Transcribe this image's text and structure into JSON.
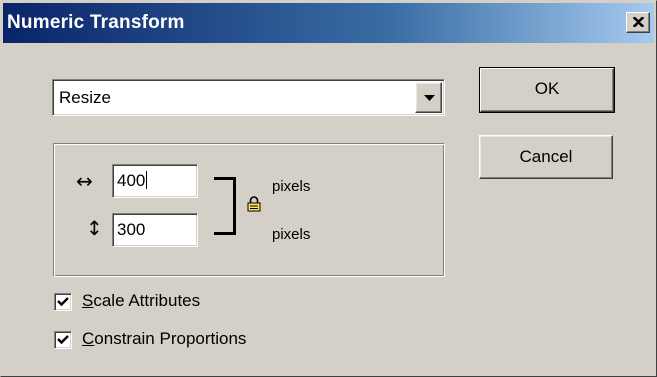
{
  "window": {
    "title": "Numeric Transform",
    "close_icon": "close-icon"
  },
  "transform": {
    "mode_selected": "Resize",
    "dropdown_icon": "chevron-down-icon"
  },
  "buttons": {
    "ok": "OK",
    "cancel": "Cancel"
  },
  "dimensions": {
    "width_icon": "↔",
    "width_value": "400",
    "width_unit": "pixels",
    "height_icon": "↕",
    "height_value": "300",
    "height_unit": "pixels",
    "link_icon": "lock-icon"
  },
  "options": [
    {
      "accel": "S",
      "rest": "cale Attributes",
      "checked": true
    },
    {
      "accel": "C",
      "rest": "onstrain Proportions",
      "checked": true
    }
  ]
}
